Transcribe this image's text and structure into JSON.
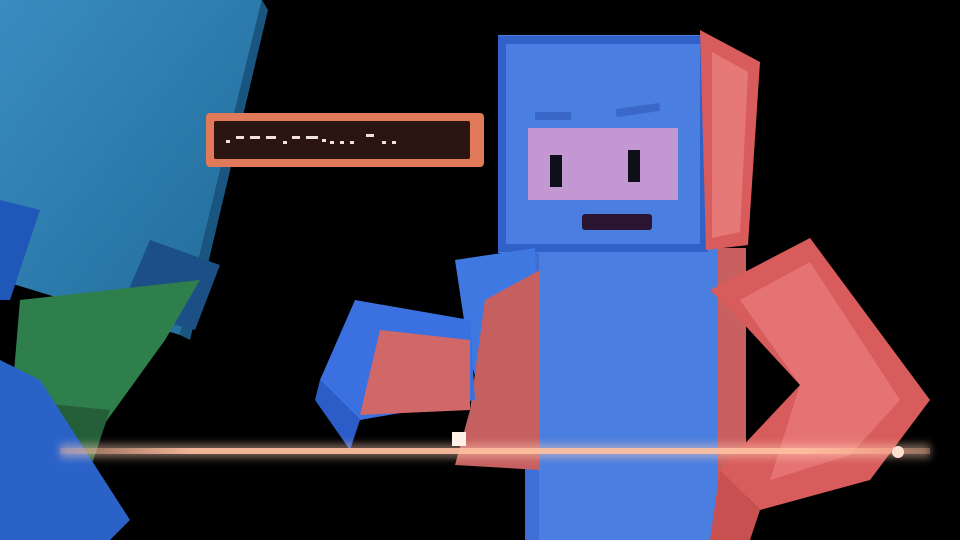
{
  "scene": {
    "background": "#000000",
    "left_character": {
      "body_color": "#2a74b0",
      "shadow_color": "#1c5a8c",
      "leg_color": "#2f7f4c"
    },
    "center_character": {
      "body_color": "#4a7ee0",
      "accent_color": "#d85c5c",
      "eye_color": "#0f0f1a",
      "mouth_color": "#2a1530"
    },
    "laser_bar": {
      "color": "#f0a080",
      "glow_color": "#ffd0b8"
    },
    "morse_panel": {
      "frame_color": "#e07a5a",
      "fill_color": "#2a1510",
      "dot_color": "#f0e0dc"
    }
  }
}
